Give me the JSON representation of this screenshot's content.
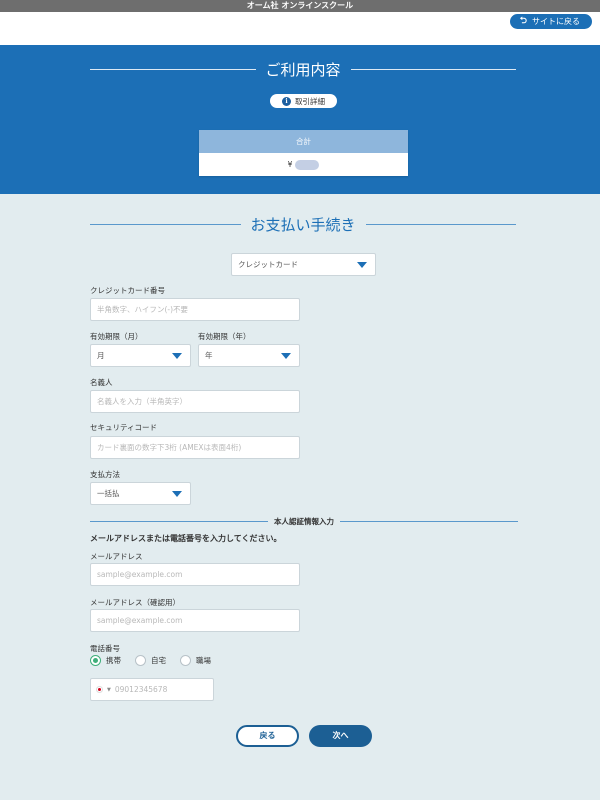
{
  "header": {
    "title": "オーム社 オンラインスクール",
    "back_to_site": "サイトに戻る"
  },
  "usage": {
    "title": "ご利用内容",
    "detail_button": "取引詳細",
    "total_label": "合計",
    "total_currency": "¥"
  },
  "payment": {
    "title": "お支払い手続き",
    "method_select": "クレジットカード",
    "card_number": {
      "label": "クレジットカード番号",
      "placeholder": "半角数字、ハイフン(-)不要"
    },
    "exp_month": {
      "label": "有効期限（月）",
      "value": "月"
    },
    "exp_year": {
      "label": "有効期限（年）",
      "value": "年"
    },
    "holder": {
      "label": "名義人",
      "placeholder": "名義人を入力（半角英字）"
    },
    "security": {
      "label": "セキュリティコード",
      "placeholder": "カード裏面の数字下3桁 (AMEXは表面4桁)"
    },
    "pay_method": {
      "label": "支払方法",
      "value": "一括払"
    }
  },
  "auth": {
    "divider": "本人認証情報入力",
    "note": "メールアドレスまたは電話番号を入力してください。",
    "email": {
      "label": "メールアドレス",
      "placeholder": "sample@example.com"
    },
    "email_confirm": {
      "label": "メールアドレス（確認用）",
      "placeholder": "sample@example.com"
    },
    "phone": {
      "label": "電話番号",
      "options": [
        "携帯",
        "自宅",
        "職場"
      ],
      "placeholder": "09012345678"
    }
  },
  "buttons": {
    "back": "戻る",
    "next": "次へ"
  },
  "colors": {
    "primary": "#1c6fb6",
    "dark_button": "#1c5f94",
    "background": "#e2ecef",
    "radio_on": "#3fae7a"
  }
}
